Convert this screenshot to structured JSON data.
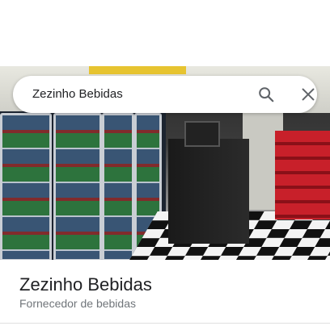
{
  "search": {
    "query": "Zezinho Bebidas"
  },
  "place": {
    "name": "Zezinho Bebidas",
    "category": "Fornecedor de bebidas"
  },
  "icons": {
    "search": "search-icon",
    "close": "close-icon"
  },
  "colors": {
    "text_primary": "#202124",
    "text_secondary": "#70757a",
    "icon": "#5f6368"
  }
}
